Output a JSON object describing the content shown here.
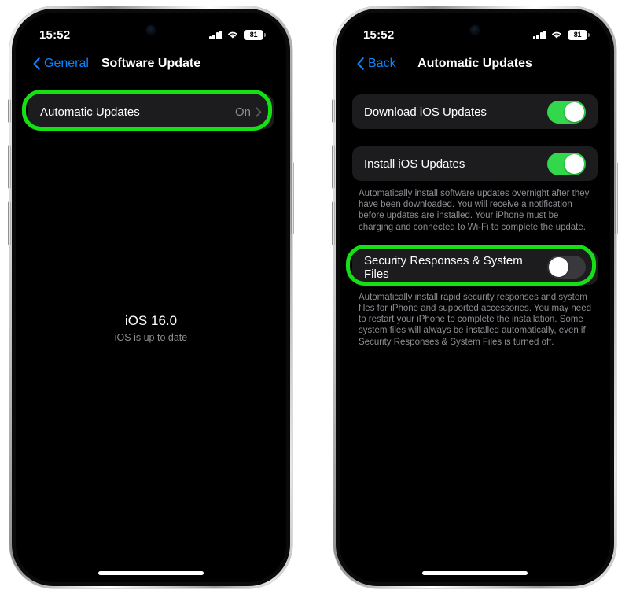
{
  "phones": [
    {
      "id": "software-update-screen",
      "status_bar": {
        "time": "15:52",
        "cellular_icon": "cellular-signal-icon",
        "wifi_icon": "wifi-icon",
        "battery_percent": "81"
      },
      "nav": {
        "back_label": "General",
        "back_icon": "chevron-left-icon",
        "title": "Software Update"
      },
      "rows": [
        {
          "label": "Automatic Updates",
          "value": "On",
          "accessory": "chevron-right-icon",
          "highlighted": true
        }
      ],
      "center_block": {
        "version": "iOS 16.0",
        "subtitle": "iOS is up to date"
      }
    },
    {
      "id": "automatic-updates-screen",
      "status_bar": {
        "time": "15:52",
        "cellular_icon": "cellular-signal-icon",
        "wifi_icon": "wifi-icon",
        "battery_percent": "81"
      },
      "nav": {
        "back_label": "Back",
        "back_icon": "chevron-left-icon",
        "title": "Automatic Updates"
      },
      "rows": [
        {
          "label": "Download iOS Updates",
          "toggle": "on",
          "highlighted": false
        },
        {
          "label": "Install iOS Updates",
          "toggle": "on",
          "highlighted": false
        },
        {
          "label": "Security Responses & System Files",
          "toggle": "off",
          "highlighted": true
        }
      ],
      "footers": [
        "Automatically install software updates overnight after they have been downloaded. You will receive a notification before updates are installed. Your iPhone must be charging and connected to Wi-Fi to complete the update.",
        "Automatically install rapid security responses and system files for iPhone and supported accessories. You may need to restart your iPhone to complete the installation. Some system files will always be installed automatically, even if Security Responses & System Files is turned off."
      ]
    }
  ],
  "colors": {
    "highlight_ring": "#14e014",
    "toggle_on": "#32d74b",
    "toggle_off": "#39393d",
    "accent_blue": "#0a84ff",
    "row_background": "#1c1c1e",
    "secondary_text": "#8e8e93"
  }
}
